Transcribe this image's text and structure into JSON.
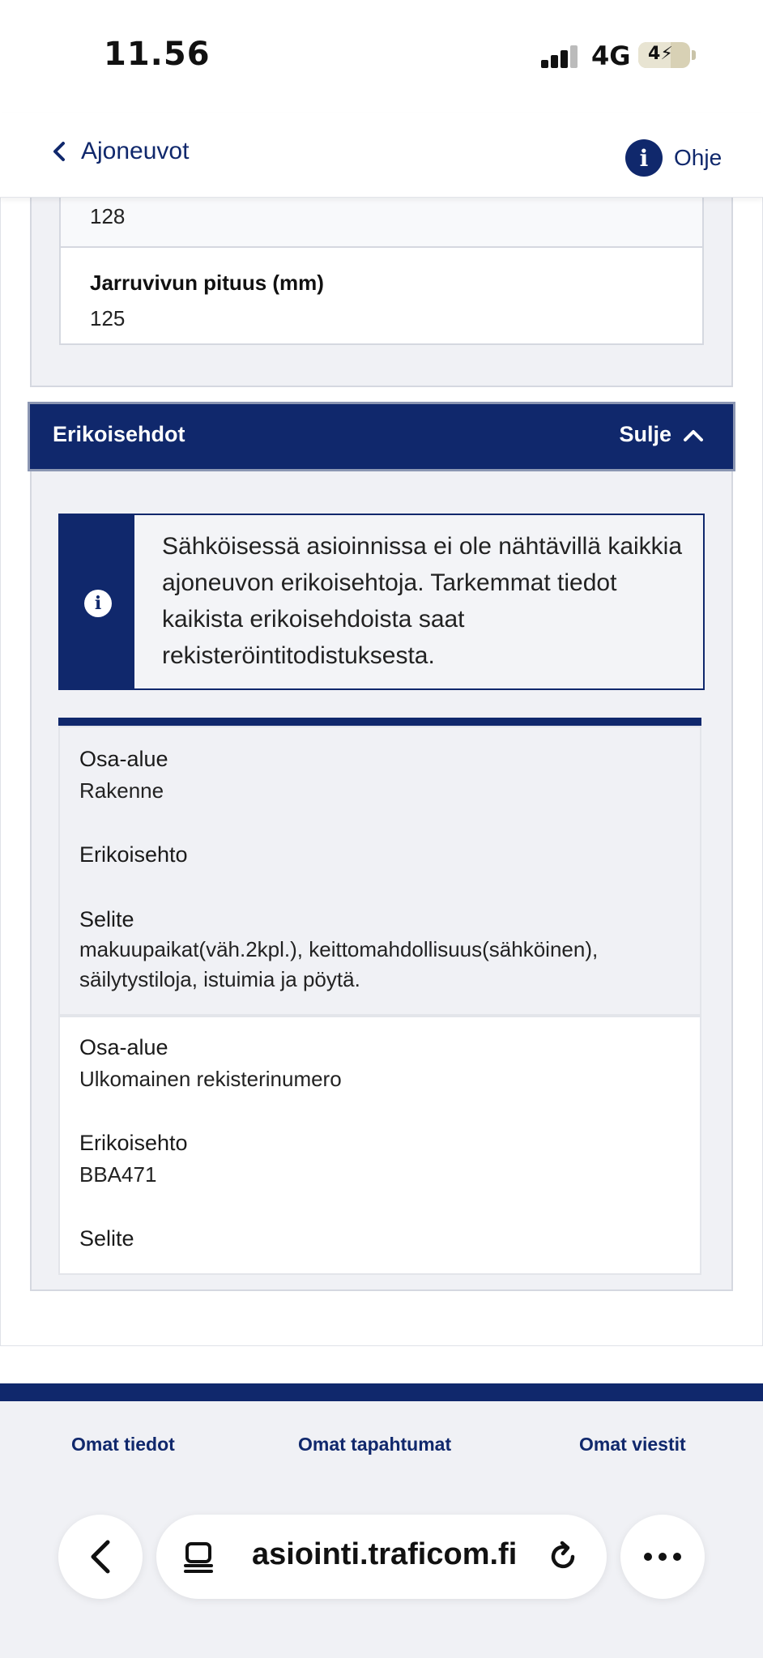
{
  "status_bar": {
    "time": "11.56",
    "network": "4G",
    "battery": "4"
  },
  "nav": {
    "back_label": "Ajoneuvot",
    "help_label": "Ohje",
    "help_glyph": "i"
  },
  "technical": {
    "partial_value": "128",
    "brake_lever_label": "Jarruvivun pituus (mm)",
    "brake_lever_value": "125"
  },
  "special_conditions": {
    "title": "Erikoisehdot",
    "close_label": "Sulje",
    "info_glyph": "i",
    "info_text": "Sähköisessä asioinnissa ei ole nähtävillä kaikkia ajoneuvon erikoisehtoja. Tarkemmat tiedot kaikista erikoisehdoista saat rekisteröintitodistuksesta.",
    "items": [
      {
        "area_label": "Osa-alue",
        "area_value": "Rakenne",
        "condition_label": "Erikoisehto",
        "condition_value": "",
        "description_label": "Selite",
        "description_value": "makuupaikat(väh.2kpl.), keittomahdollisuus(sähköinen), säilytystiloja, istuimia ja pöytä."
      },
      {
        "area_label": "Osa-alue",
        "area_value": "Ulkomainen rekisterinumero",
        "condition_label": "Erikoisehto",
        "condition_value": "BBA471",
        "description_label": "Selite",
        "description_value": ""
      }
    ]
  },
  "footer": {
    "links": [
      "Omat tiedot",
      "Omat tapahtumat",
      "Omat viestit"
    ]
  },
  "browser": {
    "url": "asiointi.traficom.fi"
  },
  "colors": {
    "brand_navy": "#10286c",
    "panel_bg": "#f0f1f5",
    "border": "#d5d8e0"
  }
}
